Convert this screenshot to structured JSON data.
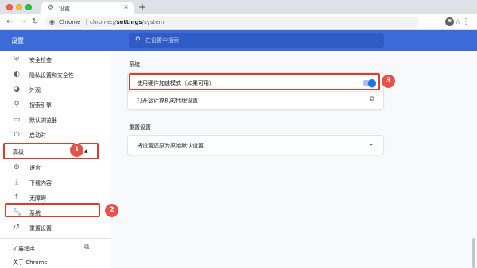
{
  "window": {
    "tab_title": "设置",
    "new_tab": "+",
    "tab_close": "×"
  },
  "toolbar": {
    "omnibox_label": "Chrome",
    "url_host": "chrome://",
    "url_path_bold": "settings",
    "url_path": "/system"
  },
  "header": {
    "title": "设置",
    "search_placeholder": "在设置中搜索"
  },
  "sidebar": {
    "items": [
      {
        "label": "安全检查",
        "icon": "shield-icon"
      },
      {
        "label": "隐私设置和安全性",
        "icon": "privacy-shield-icon"
      },
      {
        "label": "外观",
        "icon": "palette-icon"
      },
      {
        "label": "搜索引擎",
        "icon": "search-icon"
      },
      {
        "label": "默认浏览器",
        "icon": "browser-icon"
      },
      {
        "label": "启动时",
        "icon": "power-icon"
      }
    ],
    "advanced_label": "高级",
    "advanced_items": [
      {
        "label": "语言",
        "icon": "globe-icon"
      },
      {
        "label": "下载内容",
        "icon": "download-icon"
      },
      {
        "label": "无障碍",
        "icon": "accessibility-icon"
      },
      {
        "label": "系统",
        "icon": "wrench-icon"
      },
      {
        "label": "重置设置",
        "icon": "reset-icon"
      }
    ],
    "extensions_label": "扩展程序",
    "about_label": "关于 Chrome"
  },
  "main": {
    "system_section_title": "系统",
    "hardware_accel_label": "使用硬件加速模式（如果可用）",
    "hardware_accel_enabled": true,
    "proxy_label": "打开您计算机的代理设置",
    "reset_section_title": "重置设置",
    "restore_defaults_label": "将设置还原为原始默认设置"
  },
  "annotations": {
    "callout_1": "1",
    "callout_2": "2",
    "callout_3": "3",
    "color": "#e03a2e"
  },
  "colors": {
    "header_blue": "#3c6ad9",
    "toggle_blue": "#1a73e8"
  }
}
